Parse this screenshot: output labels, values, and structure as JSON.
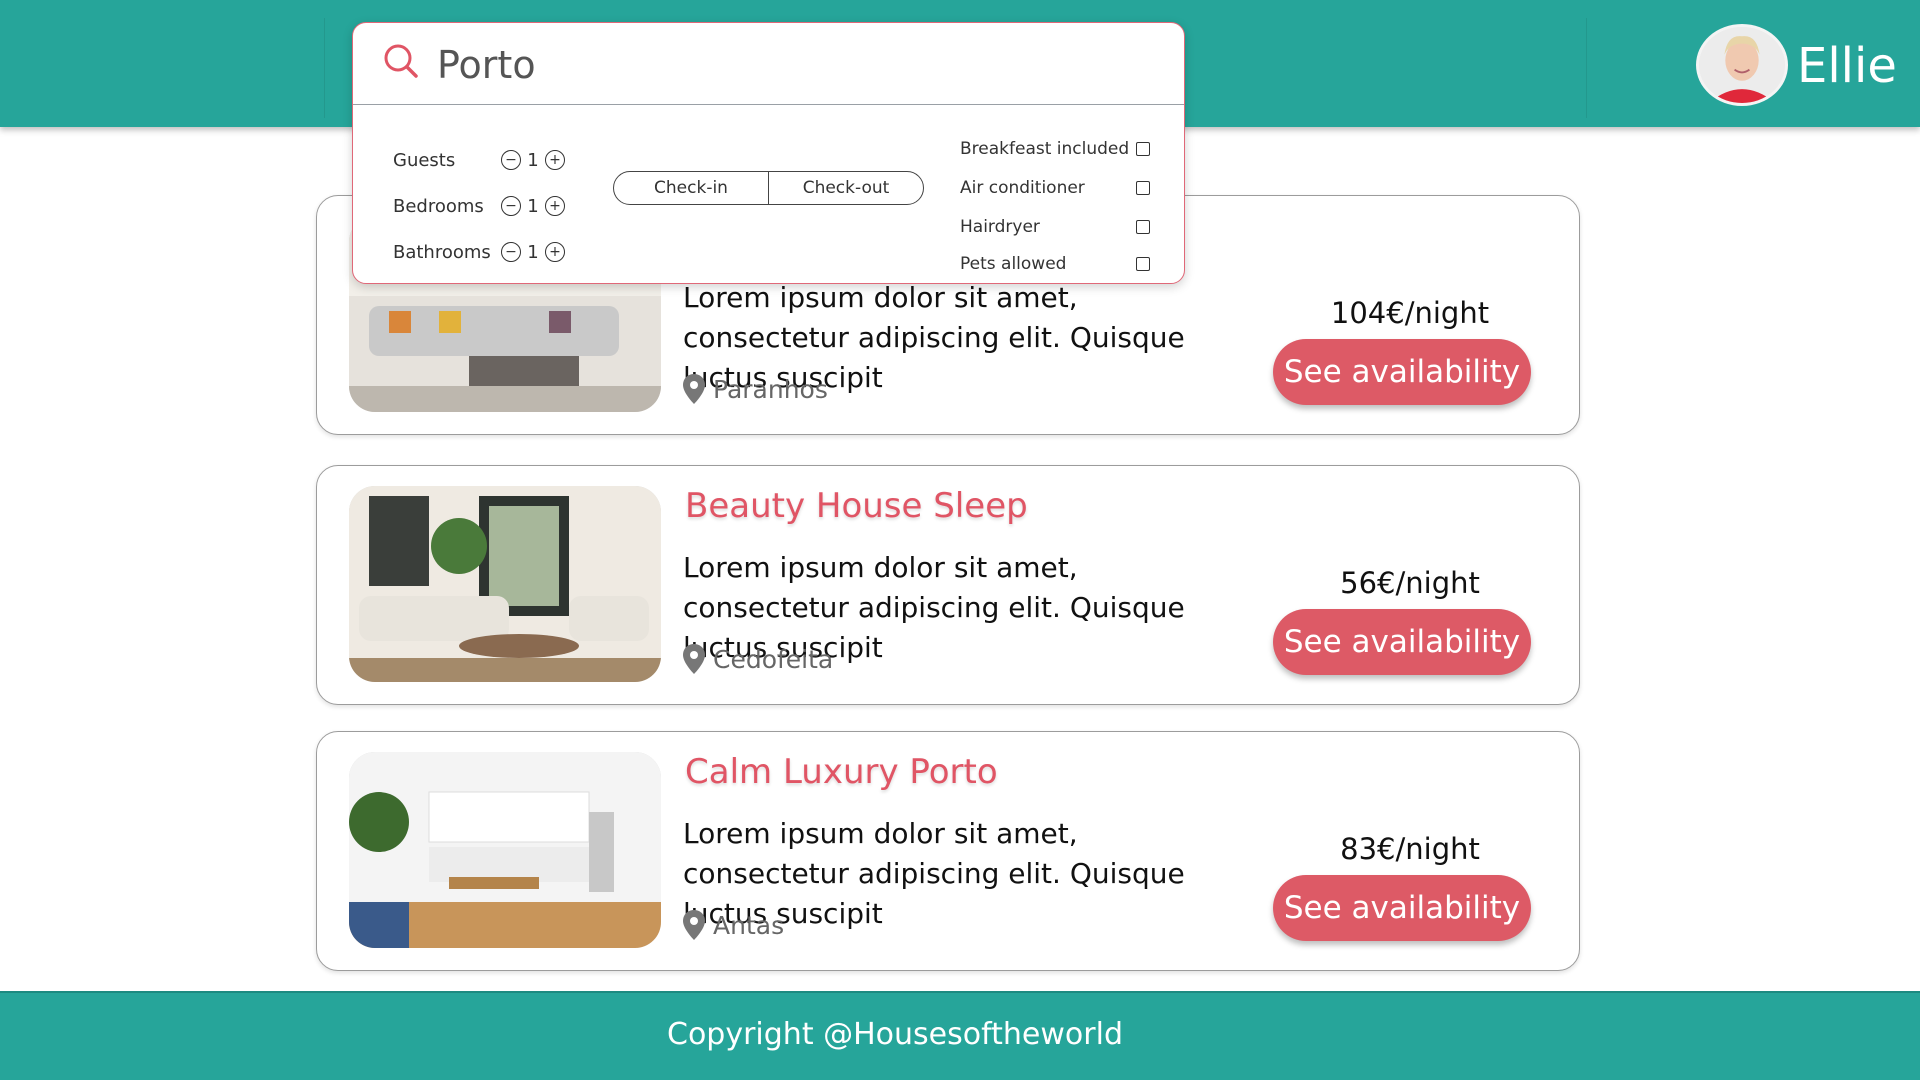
{
  "header": {
    "user_name": "Ellie",
    "avatar_alt": "Ellie profile photo"
  },
  "search": {
    "value": "Porto",
    "counters": [
      {
        "label": "Guests",
        "value": "1"
      },
      {
        "label": "Bedrooms",
        "value": "1"
      },
      {
        "label": "Bathrooms",
        "value": "1"
      }
    ],
    "checkin_label": "Check-in",
    "checkout_label": "Check-out",
    "amenities": [
      {
        "label": "Breakfeast included",
        "checked": false
      },
      {
        "label": "Air conditioner",
        "checked": false
      },
      {
        "label": "Hairdryer",
        "checked": false
      },
      {
        "label": "Pets allowed",
        "checked": false
      }
    ]
  },
  "listings": [
    {
      "title": "",
      "description": "Lorem ipsum dolor sit amet, consectetur adipiscing elit. Quisque luctus suscipit",
      "location": "Paranhos",
      "price": "104€/night",
      "button": "See availability"
    },
    {
      "title": "Beauty House Sleep",
      "description": "Lorem ipsum dolor sit amet, consectetur adipiscing elit. Quisque luctus suscipit",
      "location": "Cedofeita",
      "price": "56€/night",
      "button": "See availability"
    },
    {
      "title": "Calm Luxury Porto",
      "description": "Lorem ipsum dolor sit amet, consectetur adipiscing elit. Quisque luctus suscipit",
      "location": "Antas",
      "price": "83€/night",
      "button": "See availability"
    }
  ],
  "footer": {
    "copyright": "Copyright @Housesoftheworld"
  },
  "colors": {
    "brand_teal": "#26A59A",
    "accent_red": "#dd5a66"
  }
}
